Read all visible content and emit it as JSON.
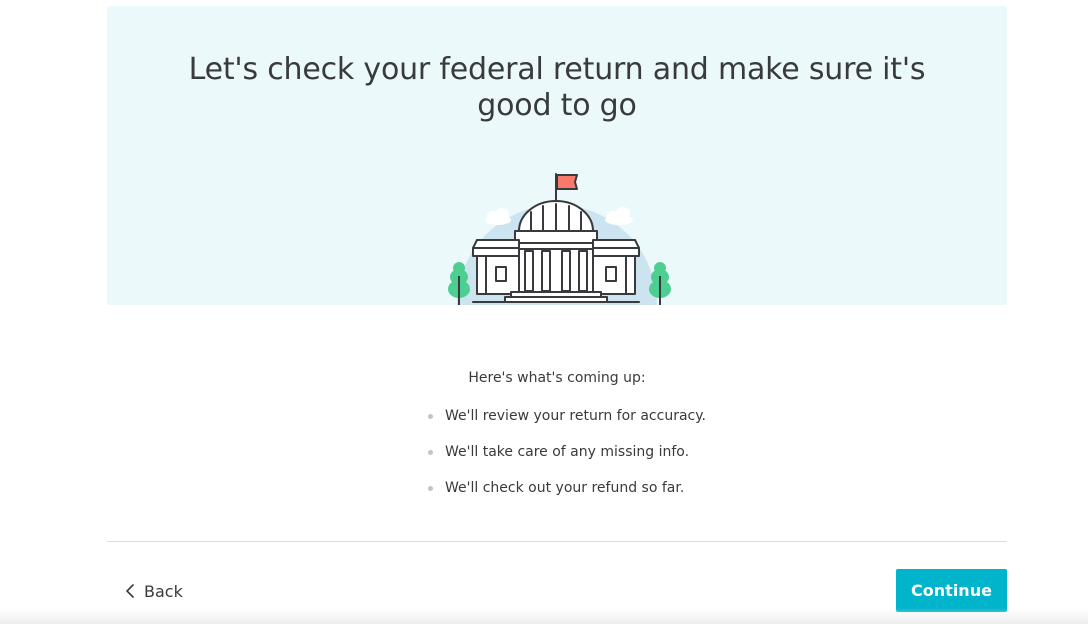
{
  "hero": {
    "title_line1": "Let's check your federal return and make sure it's",
    "title_line2": "good to go",
    "illustration": "government-building-icon"
  },
  "content": {
    "intro": "Here's what's coming up:",
    "steps": [
      "We'll review your return for accuracy.",
      "We'll take care of any missing info.",
      "We'll check out your refund so far."
    ]
  },
  "footer": {
    "back_label": "Back",
    "back_icon": "chevron-left-icon",
    "continue_label": "Continue"
  },
  "colors": {
    "hero_background": "#ecf9fa",
    "accent": "#00b4cc",
    "flag": "#f97a6a",
    "tree": "#4ccf91",
    "sky_circle": "#cbe4ef",
    "text": "#393a3d"
  }
}
